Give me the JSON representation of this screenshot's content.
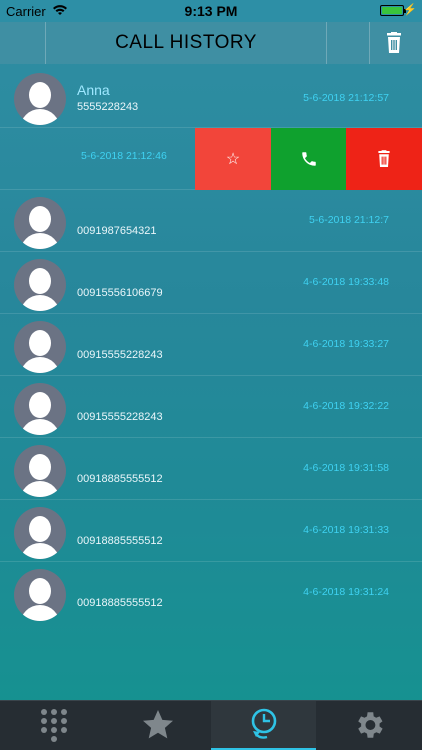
{
  "status": {
    "carrier": "Carrier",
    "time": "9:13 PM",
    "battery_level": 0.9
  },
  "header": {
    "title": "CALL HISTORY"
  },
  "calls": [
    {
      "name": "Anna",
      "number": "5555228243",
      "date": "5-6-2018 21:12:57"
    },
    {
      "name": "",
      "number": "",
      "date": "5-6-2018 21:12:46"
    },
    {
      "name": "",
      "number": "0091987654321",
      "date": "5-6-2018 21:12:7"
    },
    {
      "name": "",
      "number": "00915556106679",
      "date": "4-6-2018 19:33:48"
    },
    {
      "name": "",
      "number": "00915555228243",
      "date": "4-6-2018 19:33:27"
    },
    {
      "name": "",
      "number": "00915555228243",
      "date": "4-6-2018 19:32:22"
    },
    {
      "name": "",
      "number": "00918885555512",
      "date": "4-6-2018 19:31:58"
    },
    {
      "name": "",
      "number": "00918885555512",
      "date": "4-6-2018 19:31:33"
    },
    {
      "name": "",
      "number": "00918885555512",
      "date": "4-6-2018 19:31:24"
    }
  ],
  "swipe_actions": {
    "favorite_icon": "☆"
  },
  "colors": {
    "accent": "#2fc3e6",
    "favorite": "#f2453a",
    "call": "#0fa12e",
    "delete": "#ee2317"
  },
  "tabs": [
    {
      "icon": "keypad-icon",
      "active": false
    },
    {
      "icon": "star-icon",
      "active": false
    },
    {
      "icon": "history-icon",
      "active": true
    },
    {
      "icon": "gear-icon",
      "active": false
    }
  ]
}
